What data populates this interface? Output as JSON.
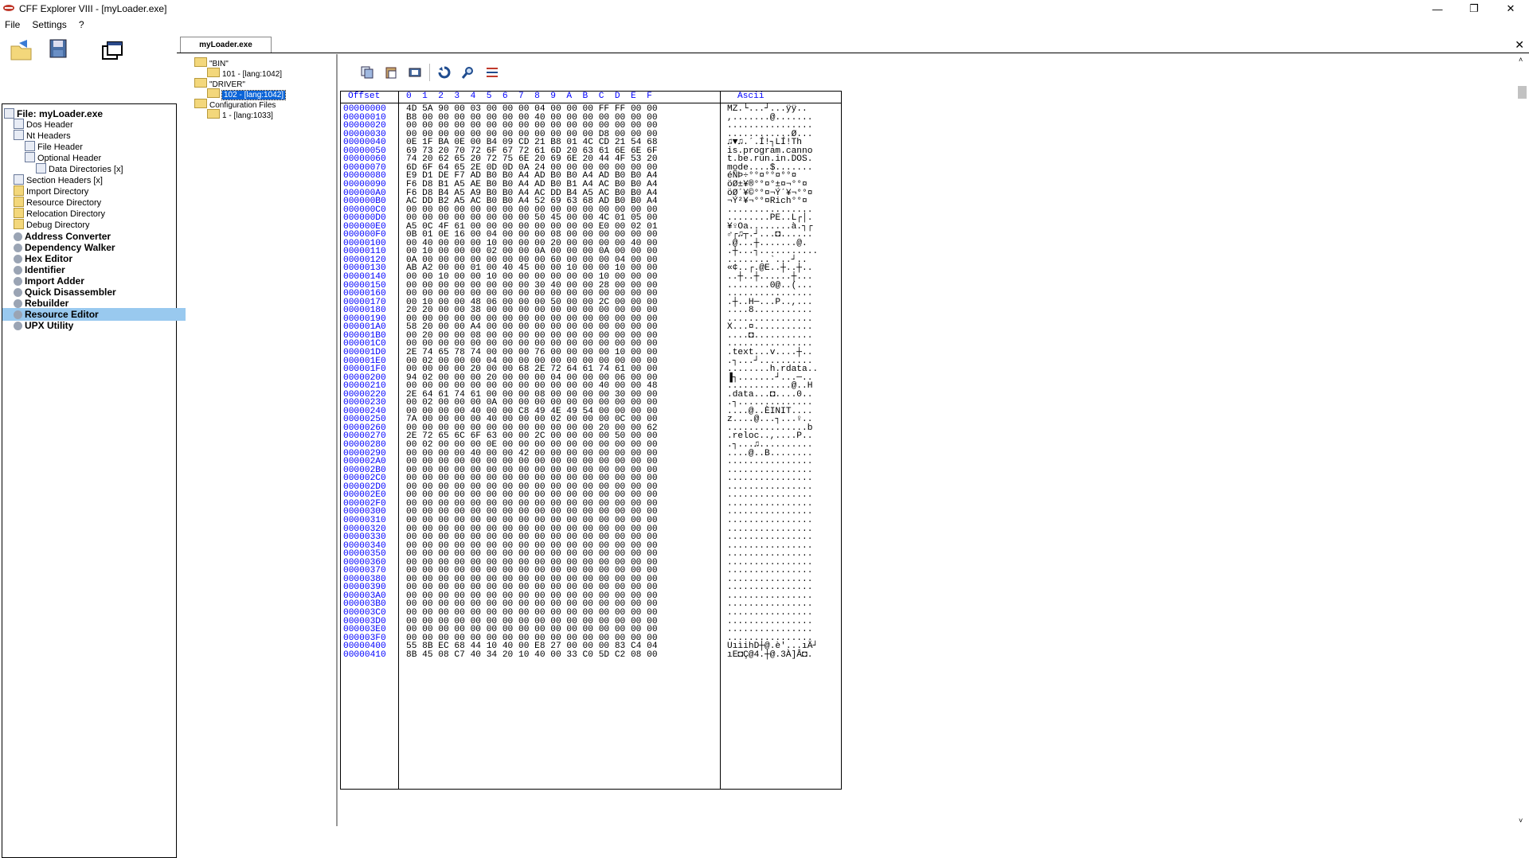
{
  "window": {
    "title": "CFF Explorer VIII - [myLoader.exe]",
    "controls": [
      "—",
      "❐",
      "✕"
    ]
  },
  "menu": [
    "File",
    "Settings",
    "?"
  ],
  "tab": {
    "label": "myLoader.exe",
    "close": "✕"
  },
  "tree": [
    {
      "label": "File: myLoader.exe",
      "bold": true
    },
    {
      "label": "Dos Header"
    },
    {
      "label": "Nt Headers"
    },
    {
      "label": "File Header"
    },
    {
      "label": "Optional Header"
    },
    {
      "label": "Data Directories [x]"
    },
    {
      "label": "Section Headers [x]"
    },
    {
      "label": "Import Directory"
    },
    {
      "label": "Resource Directory"
    },
    {
      "label": "Relocation Directory"
    },
    {
      "label": "Debug Directory"
    },
    {
      "label": "Address Converter",
      "bold": true
    },
    {
      "label": "Dependency Walker",
      "bold": true
    },
    {
      "label": "Hex Editor",
      "bold": true
    },
    {
      "label": "Identifier",
      "bold": true
    },
    {
      "label": "Import Adder",
      "bold": true
    },
    {
      "label": "Quick Disassembler",
      "bold": true
    },
    {
      "label": "Rebuilder",
      "bold": true
    },
    {
      "label": "Resource Editor",
      "bold": true,
      "selected": true
    },
    {
      "label": "UPX Utility",
      "bold": true
    }
  ],
  "resources": [
    {
      "label": "\"BIN\""
    },
    {
      "label": "101 - [lang:1042]"
    },
    {
      "label": "\"DRIVER\""
    },
    {
      "label": "102 - [lang:1042]",
      "selected": true
    },
    {
      "label": "Configuration Files"
    },
    {
      "label": "1 - [lang:1033]"
    }
  ],
  "hex": {
    "header_offset": "Offset",
    "header_cols": "0  1  2  3  4  5  6  7  8  9  A  B  C  D  E  F",
    "header_ascii": "Ascii",
    "rows": [
      [
        "00000000",
        "4D 5A 90 00 03 00 00 00 04 00 00 00 FF FF 00 00",
        "MZ.└...┘...ÿÿ.."
      ],
      [
        "00000010",
        "B8 00 00 00 00 00 00 00 40 00 00 00 00 00 00 00",
        ",.......@......."
      ],
      [
        "00000020",
        "00 00 00 00 00 00 00 00 00 00 00 00 00 00 00 00",
        "................"
      ],
      [
        "00000030",
        "00 00 00 00 00 00 00 00 00 00 00 00 D8 00 00 00",
        "............Ø..."
      ],
      [
        "00000040",
        "0E 1F BA 0E 00 B4 09 CD 21 B8 01 4C CD 21 54 68",
        "♫▼♫.´.Í!┐LÍ!Th"
      ],
      [
        "00000050",
        "69 73 20 70 72 6F 67 72 61 6D 20 63 61 6E 6E 6F",
        "is.program.canno"
      ],
      [
        "00000060",
        "74 20 62 65 20 72 75 6E 20 69 6E 20 44 4F 53 20",
        "t.be.run.in.DOS."
      ],
      [
        "00000070",
        "6D 6F 64 65 2E 0D 0D 0A 24 00 00 00 00 00 00 00",
        "mode....$......."
      ],
      [
        "00000080",
        "E9 D1 DE F7 AD B0 B0 A4 AD B0 B0 A4 AD B0 B0 A4",
        "éÑÞ÷­°°¤­°°¤­°°¤"
      ],
      [
        "00000090",
        "F6 D8 B1 A5 AE B0 B0 A4 AD B0 B1 A4 AC B0 B0 A4",
        "öØ±¥®°°¤­°±¤¬°°¤"
      ],
      [
        "000000A0",
        "F6 D8 B4 A5 A9 B0 B0 A4 AC DD B4 A5 AC B0 B0 A4",
        "öØ´¥©°°¤¬Ý´¥¬°°¤"
      ],
      [
        "000000B0",
        "AC DD B2 A5 AC B0 B0 A4 52 69 63 68 AD B0 B0 A4",
        "¬Ý²¥¬°°¤Rich­°°¤"
      ],
      [
        "000000C0",
        "00 00 00 00 00 00 00 00 00 00 00 00 00 00 00 00",
        "................"
      ],
      [
        "000000D0",
        "00 00 00 00 00 00 00 00 50 45 00 00 4C 01 05 00",
        "........PE..L┌│."
      ],
      [
        "000000E0",
        "A5 0C 4F 61 00 00 00 00 00 00 00 00 E0 00 02 01",
        "¥♀Oa........à.┐┌"
      ],
      [
        "000000F0",
        "0B 01 0E 16 00 04 00 00 00 08 00 00 00 00 00 00",
        "♂┌♫┬.┘...◘......"
      ],
      [
        "00000100",
        "00 40 00 00 00 10 00 00 00 20 00 00 00 00 40 00",
        ".@...┼.......@."
      ],
      [
        "00000110",
        "00 10 00 00 00 02 00 00 0A 00 00 00 0A 00 00 00",
        ".┼...┐..........."
      ],
      [
        "00000120",
        "0A 00 00 00 00 00 00 00 00 60 00 00 00 04 00 00",
        "........`...┘.."
      ],
      [
        "00000130",
        "AB A2 00 00 01 00 40 45 00 00 10 00 00 10 00 00",
        "«¢..┌.@E..┼..┼.."
      ],
      [
        "00000140",
        "00 00 10 00 00 10 00 00 00 00 00 00 10 00 00 00",
        "..┼..┼......┼..."
      ],
      [
        "00000150",
        "00 00 00 00 00 00 00 00 30 40 00 00 28 00 00 00",
        "........0@..(..."
      ],
      [
        "00000160",
        "00 00 00 00 00 00 00 00 00 00 00 00 00 00 00 00",
        "................"
      ],
      [
        "00000170",
        "00 10 00 00 48 06 00 00 00 50 00 00 2C 00 00 00",
        ".┼..H─...P..,..."
      ],
      [
        "00000180",
        "20 20 00 00 38 00 00 00 00 00 00 00 00 00 00 00",
        "....8..........."
      ],
      [
        "00000190",
        "00 00 00 00 00 00 00 00 00 00 00 00 00 00 00 00",
        "................"
      ],
      [
        "000001A0",
        "58 20 00 00 A4 00 00 00 00 00 00 00 00 00 00 00",
        "X...¤..........."
      ],
      [
        "000001B0",
        "00 20 00 00 08 00 00 00 00 00 00 00 00 00 00 00",
        "....◘..........."
      ],
      [
        "000001C0",
        "00 00 00 00 00 00 00 00 00 00 00 00 00 00 00 00",
        "................"
      ],
      [
        "000001D0",
        "2E 74 65 78 74 00 00 00 76 00 00 00 00 10 00 00",
        ".text...v....┼.."
      ],
      [
        "000001E0",
        "00 02 00 00 00 04 00 00 00 00 00 00 00 00 00 00",
        ".┐...┘.........."
      ],
      [
        "000001F0",
        "00 00 00 00 20 00 00 68 2E 72 64 61 74 61 00 00",
        "........h.rdata.."
      ],
      [
        "00000200",
        "94 02 00 00 00 20 00 00 00 04 00 00 00 06 00 00",
        "▐┐.......┘...─.."
      ],
      [
        "00000210",
        "00 00 00 00 00 00 00 00 00 00 00 00 40 00 00 48",
        "............@..H"
      ],
      [
        "00000220",
        "2E 64 61 74 61 00 00 00 08 00 00 00 00 30 00 00",
        ".data...◘....0.."
      ],
      [
        "00000230",
        "00 02 00 00 00 0A 00 00 00 00 00 00 00 00 00 00",
        ".┐.............."
      ],
      [
        "00000240",
        "00 00 00 00 40 00 00 C8 49 4E 49 54 00 00 00 00",
        "....@..ÈINIT...."
      ],
      [
        "00000250",
        "7A 00 00 00 00 40 00 00 00 02 00 00 00 0C 00 00",
        "z....@...┐...♀.."
      ],
      [
        "00000260",
        "00 00 00 00 00 00 00 00 00 00 00 00 20 00 00 62",
        "...............b"
      ],
      [
        "00000270",
        "2E 72 65 6C 6F 63 00 00 2C 00 00 00 00 50 00 00",
        ".reloc..,....P.."
      ],
      [
        "00000280",
        "00 02 00 00 00 0E 00 00 00 00 00 00 00 00 00 00",
        ".┐...♫.........."
      ],
      [
        "00000290",
        "00 00 00 00 40 00 00 42 00 00 00 00 00 00 00 00",
        "....@..B........"
      ],
      [
        "000002A0",
        "00 00 00 00 00 00 00 00 00 00 00 00 00 00 00 00",
        "................"
      ],
      [
        "000002B0",
        "00 00 00 00 00 00 00 00 00 00 00 00 00 00 00 00",
        "................"
      ],
      [
        "000002C0",
        "00 00 00 00 00 00 00 00 00 00 00 00 00 00 00 00",
        "................"
      ],
      [
        "000002D0",
        "00 00 00 00 00 00 00 00 00 00 00 00 00 00 00 00",
        "................"
      ],
      [
        "000002E0",
        "00 00 00 00 00 00 00 00 00 00 00 00 00 00 00 00",
        "................"
      ],
      [
        "000002F0",
        "00 00 00 00 00 00 00 00 00 00 00 00 00 00 00 00",
        "................"
      ],
      [
        "00000300",
        "00 00 00 00 00 00 00 00 00 00 00 00 00 00 00 00",
        "................"
      ],
      [
        "00000310",
        "00 00 00 00 00 00 00 00 00 00 00 00 00 00 00 00",
        "................"
      ],
      [
        "00000320",
        "00 00 00 00 00 00 00 00 00 00 00 00 00 00 00 00",
        "................"
      ],
      [
        "00000330",
        "00 00 00 00 00 00 00 00 00 00 00 00 00 00 00 00",
        "................"
      ],
      [
        "00000340",
        "00 00 00 00 00 00 00 00 00 00 00 00 00 00 00 00",
        "................"
      ],
      [
        "00000350",
        "00 00 00 00 00 00 00 00 00 00 00 00 00 00 00 00",
        "................"
      ],
      [
        "00000360",
        "00 00 00 00 00 00 00 00 00 00 00 00 00 00 00 00",
        "................"
      ],
      [
        "00000370",
        "00 00 00 00 00 00 00 00 00 00 00 00 00 00 00 00",
        "................"
      ],
      [
        "00000380",
        "00 00 00 00 00 00 00 00 00 00 00 00 00 00 00 00",
        "................"
      ],
      [
        "00000390",
        "00 00 00 00 00 00 00 00 00 00 00 00 00 00 00 00",
        "................"
      ],
      [
        "000003A0",
        "00 00 00 00 00 00 00 00 00 00 00 00 00 00 00 00",
        "................"
      ],
      [
        "000003B0",
        "00 00 00 00 00 00 00 00 00 00 00 00 00 00 00 00",
        "................"
      ],
      [
        "000003C0",
        "00 00 00 00 00 00 00 00 00 00 00 00 00 00 00 00",
        "................"
      ],
      [
        "000003D0",
        "00 00 00 00 00 00 00 00 00 00 00 00 00 00 00 00",
        "................"
      ],
      [
        "000003E0",
        "00 00 00 00 00 00 00 00 00 00 00 00 00 00 00 00",
        "................"
      ],
      [
        "000003F0",
        "00 00 00 00 00 00 00 00 00 00 00 00 00 00 00 00",
        "................"
      ],
      [
        "00000400",
        "55 8B EC 68 44 10 40 00 E8 27 00 00 00 83 C4 04",
        "UıìihD┼@.è'...ıÄ┘"
      ],
      [
        "00000410",
        "8B 45 08 C7 40 34 20 10 40 00 33 C0 5D C2 08 00",
        "ıE◘Ç@4.┼@.3À]Â◘."
      ]
    ]
  }
}
